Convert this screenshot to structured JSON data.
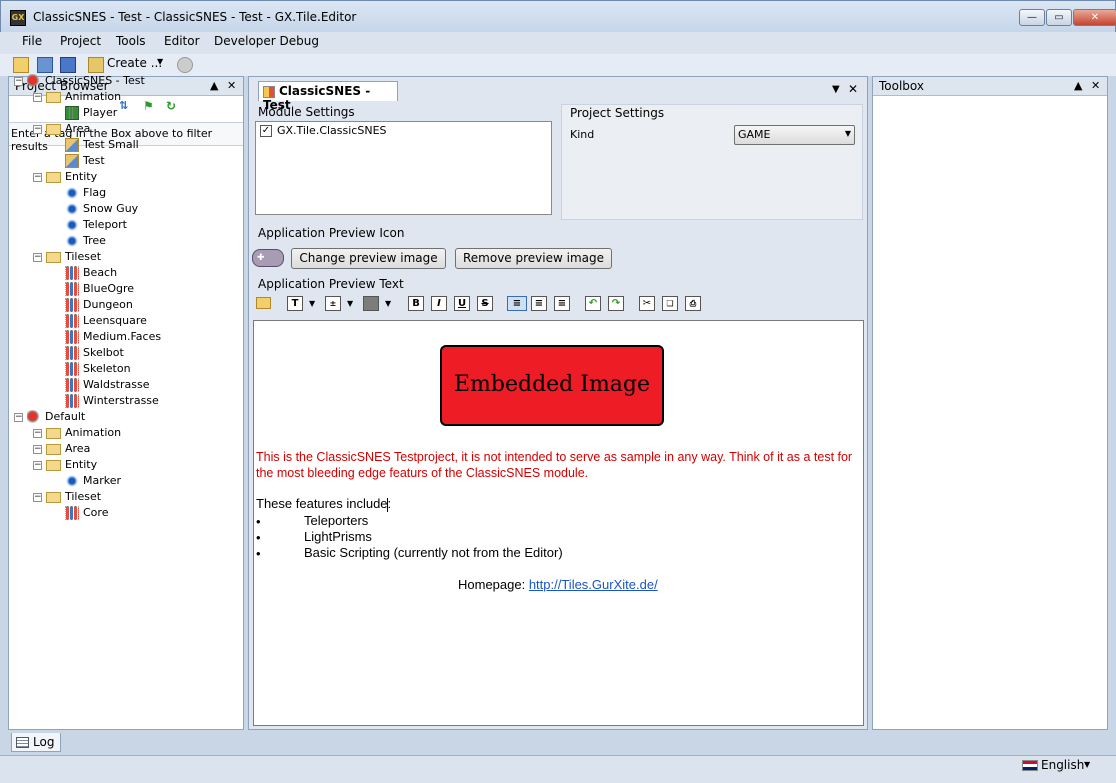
{
  "window": {
    "title": "ClassicSNES - Test - ClassicSNES - Test - GX.Tile.Editor",
    "app_badge": "GX"
  },
  "menu": {
    "items": [
      "File",
      "Project",
      "Tools",
      "Editor",
      "Developer Debug"
    ]
  },
  "toolbar": {
    "create_label": "Create ..."
  },
  "project_browser": {
    "title": "Project Browser",
    "filter_hint": "Enter a tag in the Box above to filter results",
    "tree": [
      {
        "label": "ClassicSNES - Test",
        "level": 0,
        "icon": "project"
      },
      {
        "label": "Animation",
        "level": 1,
        "icon": "folder"
      },
      {
        "label": "Player",
        "level": 2,
        "icon": "animation"
      },
      {
        "label": "Area",
        "level": 1,
        "icon": "folder"
      },
      {
        "label": "Test Small",
        "level": 2,
        "icon": "area"
      },
      {
        "label": "Test",
        "level": 2,
        "icon": "area"
      },
      {
        "label": "Entity",
        "level": 1,
        "icon": "folder"
      },
      {
        "label": "Flag",
        "level": 2,
        "icon": "entity"
      },
      {
        "label": "Snow Guy",
        "level": 2,
        "icon": "entity"
      },
      {
        "label": "Teleport",
        "level": 2,
        "icon": "entity"
      },
      {
        "label": "Tree",
        "level": 2,
        "icon": "entity"
      },
      {
        "label": "Tileset",
        "level": 1,
        "icon": "folder"
      },
      {
        "label": "Beach",
        "level": 2,
        "icon": "tileset"
      },
      {
        "label": "BlueOgre",
        "level": 2,
        "icon": "tileset"
      },
      {
        "label": "Dungeon",
        "level": 2,
        "icon": "tileset"
      },
      {
        "label": "Leensquare",
        "level": 2,
        "icon": "tileset"
      },
      {
        "label": "Medium.Faces",
        "level": 2,
        "icon": "tileset"
      },
      {
        "label": "Skelbot",
        "level": 2,
        "icon": "tileset"
      },
      {
        "label": "Skeleton",
        "level": 2,
        "icon": "tileset"
      },
      {
        "label": "Waldstrasse",
        "level": 2,
        "icon": "tileset"
      },
      {
        "label": "Winterstrasse",
        "level": 2,
        "icon": "tileset"
      },
      {
        "label": "Default",
        "level": 0,
        "icon": "project"
      },
      {
        "label": "Animation",
        "level": 1,
        "icon": "folder"
      },
      {
        "label": "Area",
        "level": 1,
        "icon": "folder"
      },
      {
        "label": "Entity",
        "level": 1,
        "icon": "folder"
      },
      {
        "label": "Marker",
        "level": 2,
        "icon": "entity"
      },
      {
        "label": "Tileset",
        "level": 1,
        "icon": "folder"
      },
      {
        "label": "Core",
        "level": 2,
        "icon": "tileset"
      }
    ]
  },
  "document": {
    "tab_label": "ClassicSNES - Test",
    "module_settings": {
      "label": "Module Settings",
      "module_name": "GX.Tile.ClassicSNES",
      "checked": true
    },
    "project_settings": {
      "label": "Project Settings",
      "kind_label": "Kind",
      "kind_value": "GAME"
    },
    "preview_icon": {
      "label": "Application Preview Icon",
      "change_button": "Change preview image",
      "remove_button": "Remove preview image"
    },
    "preview_text": {
      "label": "Application Preview Text",
      "embedded_image": "Embedded Image",
      "intro": "This is the ClassicSNES Testproject, it is not intended to serve as sample in any way. Think of it as a test for the most bleeding edge featurs of the ClassicSNES module.",
      "features_heading": "These features include:",
      "features": [
        "Teleporters",
        "LightPrisms",
        "Basic Scripting (currently not from the Editor)"
      ],
      "homepage_label": "Homepage: ",
      "homepage_url": "http://Tiles.GurXite.de/",
      "format_bold": "B",
      "format_italic": "I",
      "format_underline": "U",
      "format_strike": "S",
      "format_font": "T"
    }
  },
  "toolbox": {
    "title": "Toolbox"
  },
  "log_tab": {
    "label": "Log"
  },
  "status": {
    "language": "English"
  },
  "colors": {
    "intro_text": "#d40000",
    "embedded_bg": "#ee1c24",
    "link": "#1a55c7"
  }
}
